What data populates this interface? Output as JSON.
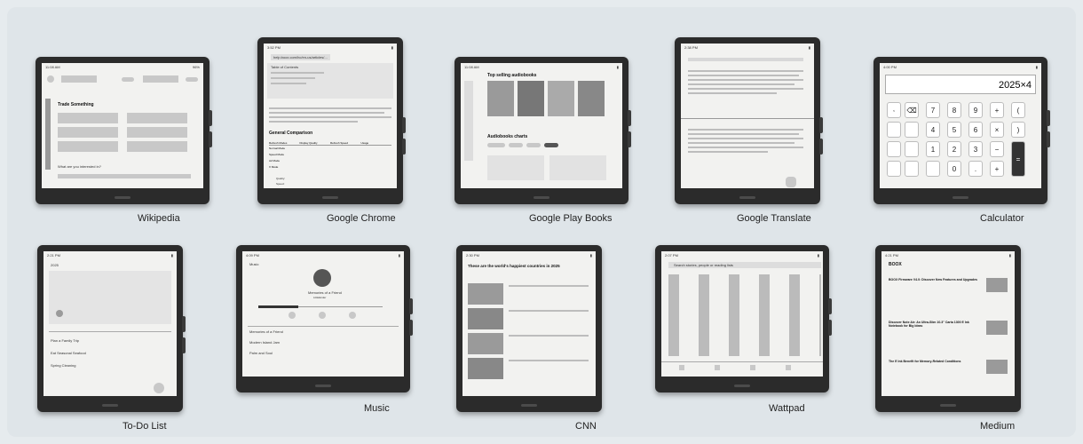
{
  "apps": [
    {
      "label": "Wikipedia"
    },
    {
      "label": "Google Chrome"
    },
    {
      "label": "Google Play Books"
    },
    {
      "label": "Google Translate"
    },
    {
      "label": "Calculator"
    },
    {
      "label": "To-Do List"
    },
    {
      "label": "Music"
    },
    {
      "label": "CNN"
    },
    {
      "label": "Wattpad"
    },
    {
      "label": "Medium"
    }
  ],
  "screens": {
    "wikipedia": {
      "time": "11:08 AM",
      "battery": "96%",
      "section": "Trade Something",
      "footer": "What are you interested in?"
    },
    "chrome": {
      "time": "3:52 PM",
      "url": "help.boox.com/hc/en-us/articles/...",
      "toc": "Table of Contents",
      "heading": "General Comparison",
      "table_headers": [
        "Refresh Modes",
        "Display Quality",
        "Refresh Speed",
        "Usage"
      ],
      "rows": [
        "Normal Mode",
        "Speed Mode",
        "A2 Mode",
        "X Mode"
      ],
      "legend_quality": "Quality:",
      "legend_speed": "Speed:"
    },
    "playbooks": {
      "time": "11:08 AM",
      "heading": "Top selling audiobooks",
      "sub": "Audiobooks charts"
    },
    "translate": {
      "time": "2:38 PM"
    },
    "calculator": {
      "time": "4:00 PM",
      "display": "2025×4",
      "keys": [
        "⌫",
        "7",
        "8",
        "9",
        "+",
        "(",
        "",
        "4",
        "5",
        "6",
        "×",
        ")",
        "",
        "1",
        "2",
        "3",
        "−",
        "",
        "",
        "0",
        ".",
        "+",
        "="
      ]
    },
    "todo": {
      "time": "2:21 PM",
      "month": "2025",
      "items": [
        "Plan a Family Trip",
        "Eat Seasonal Seafood",
        "Spring Cleaning"
      ]
    },
    "music": {
      "time": "4:09 PM",
      "nav": "Music",
      "track": "Memories of a Friend",
      "artist": "LittleEnder",
      "list": [
        "Memories of a Friend",
        "Modern Island Jam",
        "Palm and Soul"
      ]
    },
    "cnn": {
      "time": "2:30 PM",
      "headline": "These are the world's happiest countries in 2025"
    },
    "wattpad": {
      "time": "2:07 PM",
      "search": "Search stories, people or reading lists"
    },
    "medium": {
      "time": "4:21 PM",
      "title": "BOOX",
      "articles": [
        "BOOX Firmware V4.0: Discover New Features and Upgrades",
        "Discover Note Air: An Ultra-Slim 10.3\" Carta 1300 E Ink Notebook for Big Ideas",
        "The E Ink Benefit for Memory-Related Conditions"
      ]
    }
  }
}
